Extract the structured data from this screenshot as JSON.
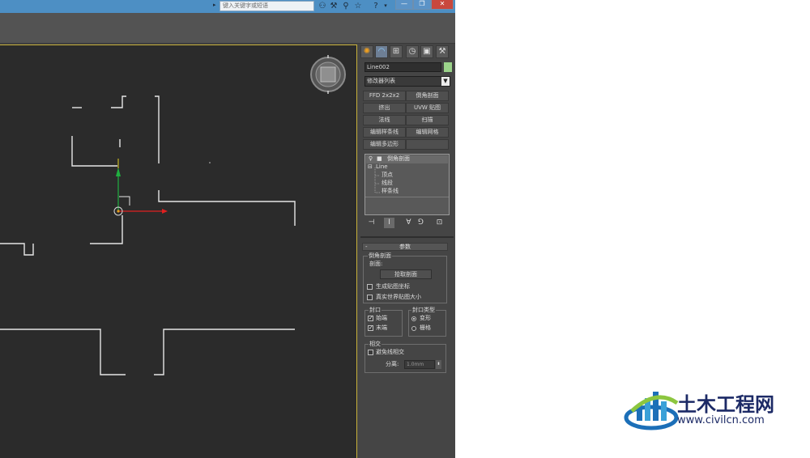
{
  "titlebar": {
    "search_placeholder": "键入关键字或短语",
    "minimize": "—",
    "restore": "❐",
    "close": "✕"
  },
  "command_panel": {
    "object_name": "Line002",
    "object_color": "#9bd38a",
    "modifier_list": "修改器列表",
    "modifier_buttons": [
      "FFD 2x2x2",
      "倒角剖面",
      "挤出",
      "UVW 贴图",
      "法线",
      "扫描",
      "编辑样条线",
      "编辑网格",
      "编辑多边形"
    ],
    "stack": {
      "top_modifier": "倒角剖面",
      "base_object": "Line",
      "sub_objects": [
        "顶点",
        "线段",
        "样条线"
      ]
    },
    "parameters": {
      "title": "参数",
      "bevel_profile_group": "倒角剖面",
      "profile_label": "剖面:",
      "pick_profile_button": "拾取剖面",
      "generate_mapping": "生成贴图坐标",
      "real_world_map_size": "真实世界贴图大小",
      "capping_group": "封口",
      "cap_start": "始端",
      "cap_end": "末端",
      "cap_type_group": "封口类型",
      "cap_type_morph": "变形",
      "cap_type_grid": "栅格",
      "intersections_group": "相交",
      "avoid_self_intersect": "避免线相交",
      "separation_label": "分离:",
      "separation_value": "1.0mm"
    }
  },
  "watermark": {
    "title": "土木工程网",
    "url": "www.civilcn.com"
  }
}
